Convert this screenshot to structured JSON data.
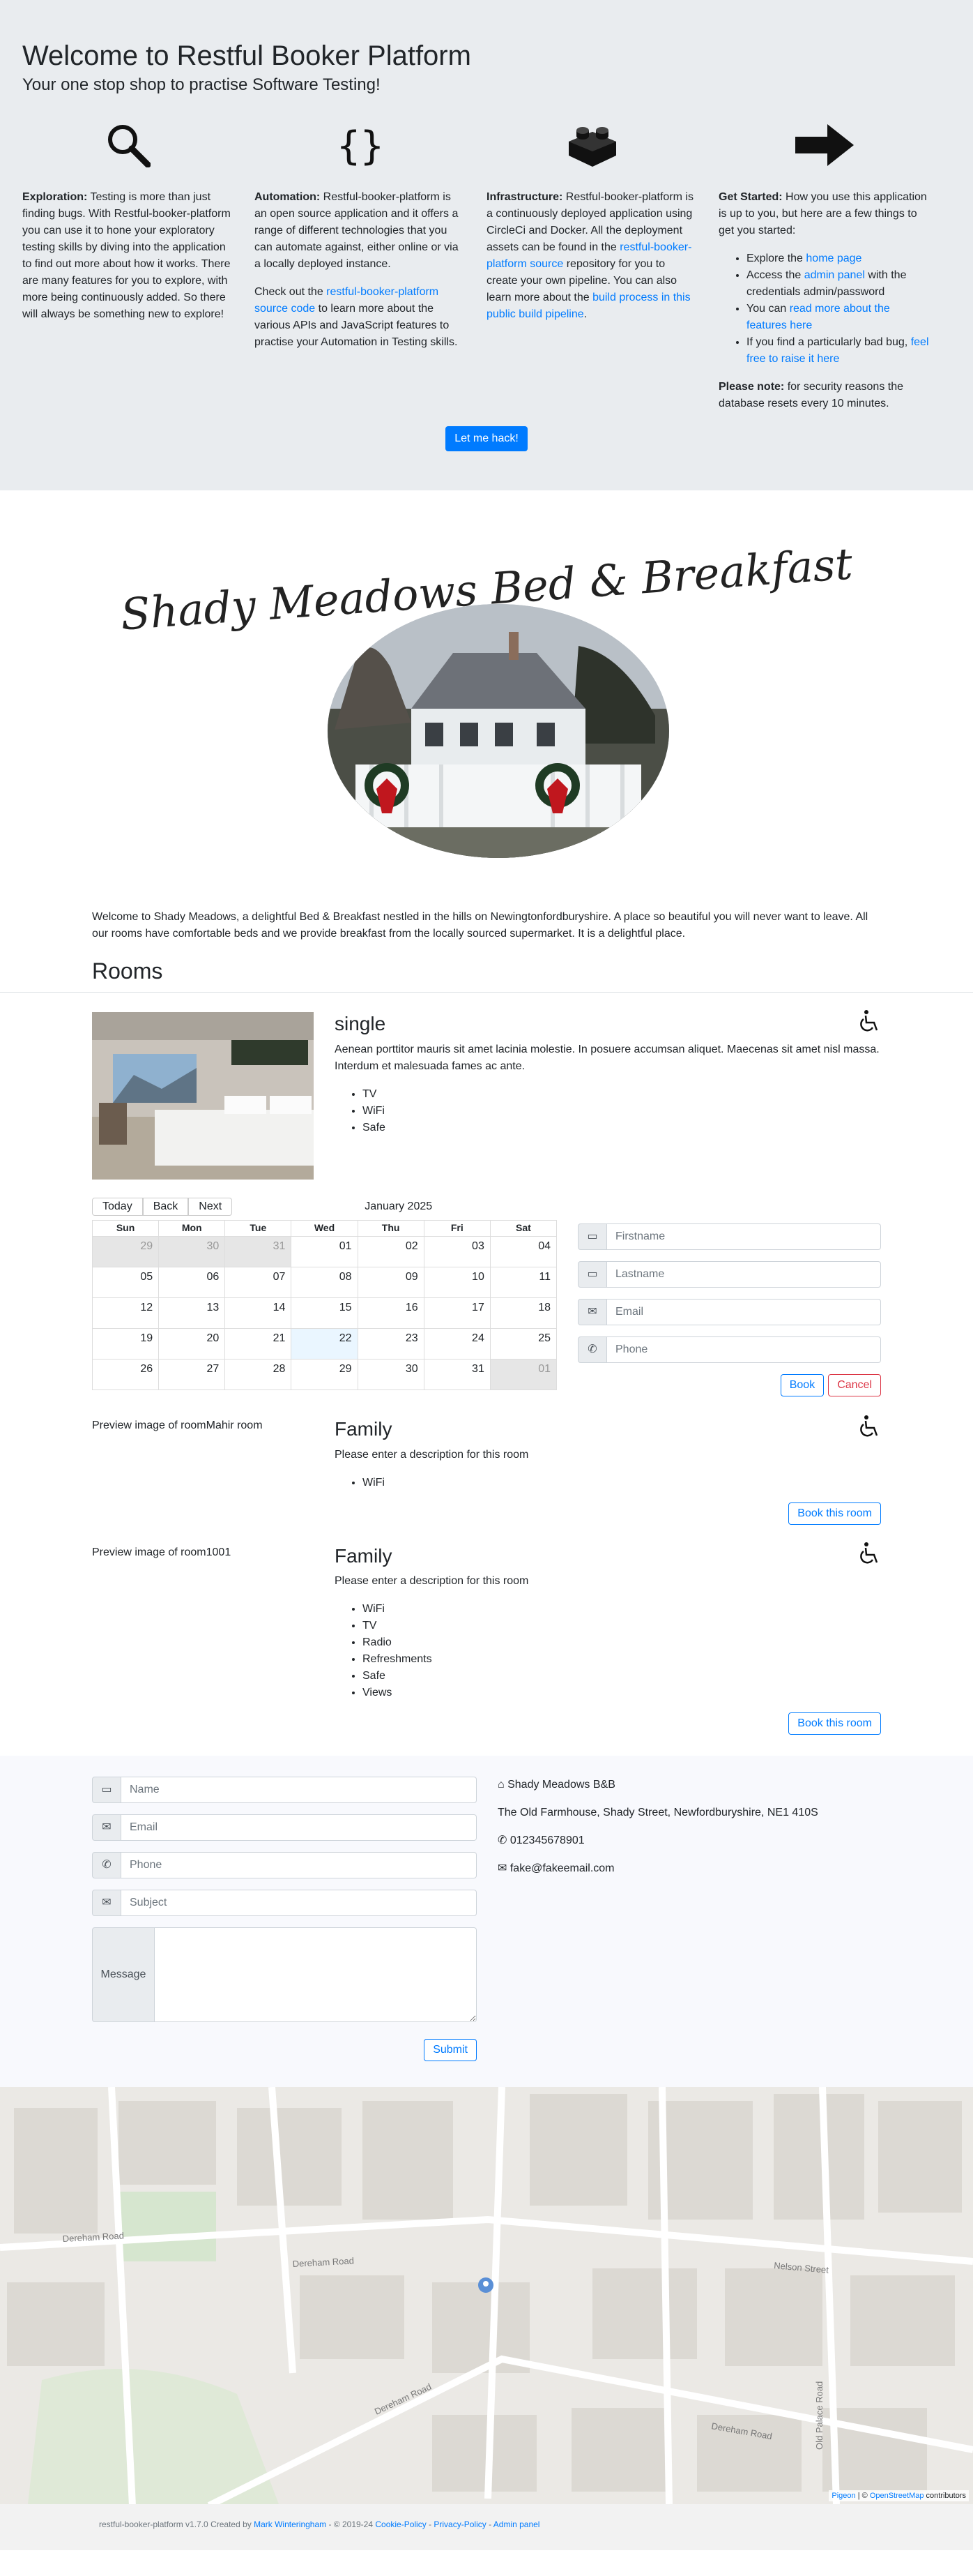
{
  "hero": {
    "title": "Welcome to Restful Booker Platform",
    "subtitle": "Your one stop shop to practise Software Testing!",
    "exploration": {
      "label": "Exploration:",
      "text": " Testing is more than just finding bugs. With Restful-booker-platform you can use it to hone your exploratory testing skills by diving into the application to find out more about how it works. There are many features for you to explore, with more being continuously added. So there will always be something new to explore!"
    },
    "automation": {
      "label": "Automation:",
      "text": " Restful-booker-platform is an open source application and it offers a range of different technologies that you can automate against, either online or via a locally deployed instance.",
      "p2_pre": "Check out the ",
      "p2_link": "restful-booker-platform source code",
      "p2_post": " to learn more about the various APIs and JavaScript features to practise your Automation in Testing skills."
    },
    "infrastructure": {
      "label": "Infrastructure:",
      "text": " Restful-booker-platform is a continuously deployed application using CircleCi and Docker. All the deployment assets can be found in the ",
      "link1": "restful-booker-platform source",
      "mid": " repository for you to create your own pipeline. You can also learn more about the ",
      "link2": "build process in this public build pipeline",
      "end": "."
    },
    "get_started": {
      "label": "Get Started:",
      "text": " How you use this application is up to you, but here are a few things to get you started:",
      "li1_pre": "Explore the ",
      "li1_link": "home page",
      "li2_pre": "Access the ",
      "li2_link": "admin panel",
      "li2_post": " with the credentials admin/password",
      "li3_pre": "You can ",
      "li3_link": "read more about the features here",
      "li4_pre": "If you find a particularly bad bug, ",
      "li4_link": "feel free to raise it here",
      "note_label": "Please note:",
      "note_text": " for security reasons the database resets every 10 minutes."
    },
    "hack_button": "Let me hack!"
  },
  "logo": {
    "title": "Shady Meadows Bed & Breakfast"
  },
  "intro": "Welcome to Shady Meadows, a delightful Bed & Breakfast nestled in the hills on Newingtonfordburyshire. A place so beautiful you will never want to leave. All our rooms have comfortable beds and we provide breakfast from the locally sourced supermarket. It is a delightful place.",
  "rooms_title": "Rooms",
  "room1": {
    "name": "single",
    "description": "Aenean porttitor mauris sit amet lacinia molestie. In posuere accumsan aliquet. Maecenas sit amet nisl massa. Interdum et malesuada fames ac ante.",
    "features": [
      "TV",
      "WiFi",
      "Safe"
    ]
  },
  "calendar": {
    "today": "Today",
    "back": "Back",
    "next": "Next",
    "label": "January 2025",
    "days": [
      "Sun",
      "Mon",
      "Tue",
      "Wed",
      "Thu",
      "Fri",
      "Sat"
    ],
    "weeks": [
      [
        "29",
        "30",
        "31",
        "01",
        "02",
        "03",
        "04"
      ],
      [
        "05",
        "06",
        "07",
        "08",
        "09",
        "10",
        "11"
      ],
      [
        "12",
        "13",
        "14",
        "15",
        "16",
        "17",
        "18"
      ],
      [
        "19",
        "20",
        "21",
        "22",
        "23",
        "24",
        "25"
      ],
      [
        "26",
        "27",
        "28",
        "29",
        "30",
        "31",
        "01"
      ]
    ]
  },
  "booking_form": {
    "firstname": "Firstname",
    "lastname": "Lastname",
    "email": "Email",
    "phone": "Phone",
    "book": "Book",
    "cancel": "Cancel"
  },
  "room2": {
    "alt": "Preview image of roomMahir room",
    "name": "Family",
    "description": "Please enter a description for this room",
    "features": [
      "WiFi"
    ],
    "button": "Book this room"
  },
  "room3": {
    "alt": "Preview image of room1001",
    "name": "Family",
    "description": "Please enter a description for this room",
    "features": [
      "WiFi",
      "TV",
      "Radio",
      "Refreshments",
      "Safe",
      "Views"
    ],
    "button": "Book this room"
  },
  "contact_form": {
    "name": "Name",
    "email": "Email",
    "phone": "Phone",
    "subject": "Subject",
    "message": "Message",
    "submit": "Submit"
  },
  "contact_info": {
    "name": "Shady Meadows B&B",
    "address": "The Old Farmhouse, Shady Street, Newfordburyshire, NE1 410S",
    "phone": "012345678901",
    "email": "fake@fakeemail.com"
  },
  "map": {
    "streets": [
      "Dereham Road",
      "Dereham Road",
      "Dereham Road",
      "Dereham Road",
      "Old Palace Road",
      "Nelson Street"
    ],
    "attribution_link1": "Pigeon",
    "attribution_sep": " | © ",
    "attribution_link2": "OpenStreetMap",
    "attribution_post": " contributors"
  },
  "footer": {
    "pre": "restful-booker-platform v1.7.0 Created by ",
    "author": "Mark Winteringham",
    "mid": " - © 2019-24 ",
    "cookie": "Cookie-Policy",
    "dash1": " - ",
    "privacy": "Privacy-Policy",
    "dash2": " - ",
    "admin": "Admin panel"
  },
  "colors": {
    "primary": "#007bff",
    "danger": "#dc3545",
    "hero_bg": "#e9ecef",
    "calendar_off": "#e6e6e6",
    "calendar_today": "#eaf6ff"
  }
}
